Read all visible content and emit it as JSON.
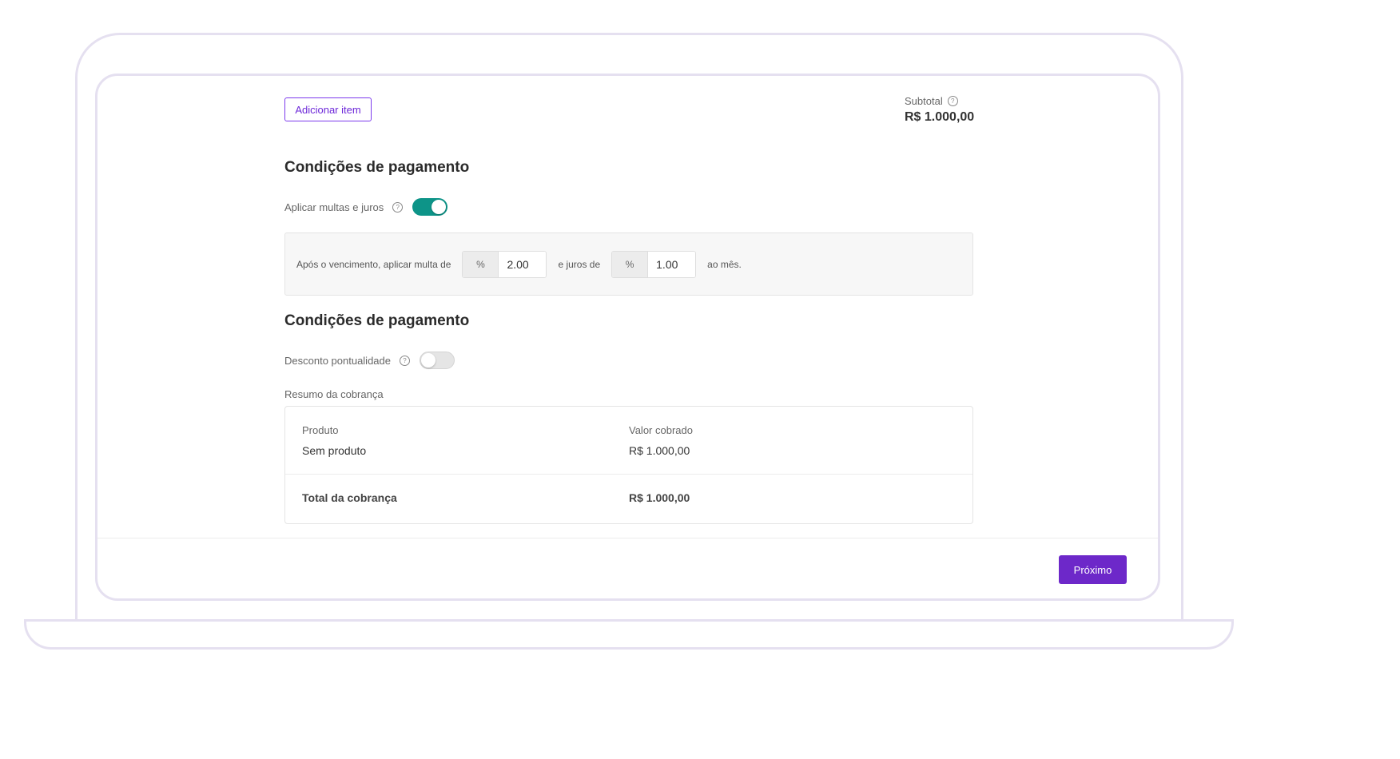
{
  "toolbar": {
    "add_item_label": "Adicionar item"
  },
  "subtotal": {
    "label": "Subtotal",
    "value": "R$ 1.000,00"
  },
  "payment_conditions": {
    "title": "Condições de pagamento",
    "fines_toggle_label": "Aplicar multas e juros",
    "fines_toggle_on": true,
    "fine_text_before": "Após o vencimento, aplicar multa de",
    "fine_addon": "%",
    "fine_value": "2.00",
    "interest_text": "e juros de",
    "interest_addon": "%",
    "interest_value": "1.00",
    "fine_text_after": "ao mês."
  },
  "discount_conditions": {
    "title": "Condições de pagamento",
    "discount_toggle_label": "Desconto pontualidade",
    "discount_toggle_on": false
  },
  "summary": {
    "label": "Resumo da cobrança",
    "col_product": "Produto",
    "col_value": "Valor cobrado",
    "product": "Sem produto",
    "value": "R$ 1.000,00",
    "total_label": "Total da cobrança",
    "total_value": "R$ 1.000,00"
  },
  "footer": {
    "next_label": "Próximo"
  },
  "colors": {
    "accent": "#6d28c9",
    "toggle_on": "#0d9488",
    "frame": "#e5e0f0"
  }
}
